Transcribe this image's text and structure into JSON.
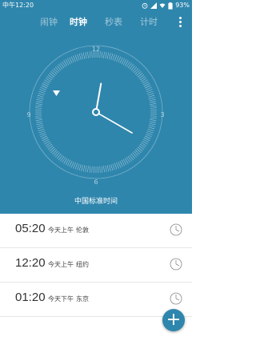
{
  "status_bar": {
    "time": "中午12:20",
    "battery": "93%",
    "icons": [
      "alarm-icon",
      "signal-icon",
      "wifi-icon",
      "battery-icon"
    ]
  },
  "tabs": [
    {
      "label": "闹钟",
      "active": false
    },
    {
      "label": "时钟",
      "active": true
    },
    {
      "label": "秒表",
      "active": false
    },
    {
      "label": "计时",
      "active": false
    }
  ],
  "clock": {
    "numerals": {
      "top": "12",
      "right": "3",
      "bottom": "6",
      "left": "9"
    },
    "time": {
      "hour": 12,
      "minute": 20
    },
    "timezone_label": "中国标准时间"
  },
  "world_clocks": [
    {
      "time": "05:20",
      "day_period": "今天上午",
      "city": "伦敦"
    },
    {
      "time": "12:20",
      "day_period": "今天上午",
      "city": "纽约"
    },
    {
      "time": "01:20",
      "day_period": "今天下午",
      "city": "东京"
    }
  ],
  "fab": {
    "label": "+"
  },
  "colors": {
    "primary": "#2f86ad",
    "white": "#ffffff"
  }
}
